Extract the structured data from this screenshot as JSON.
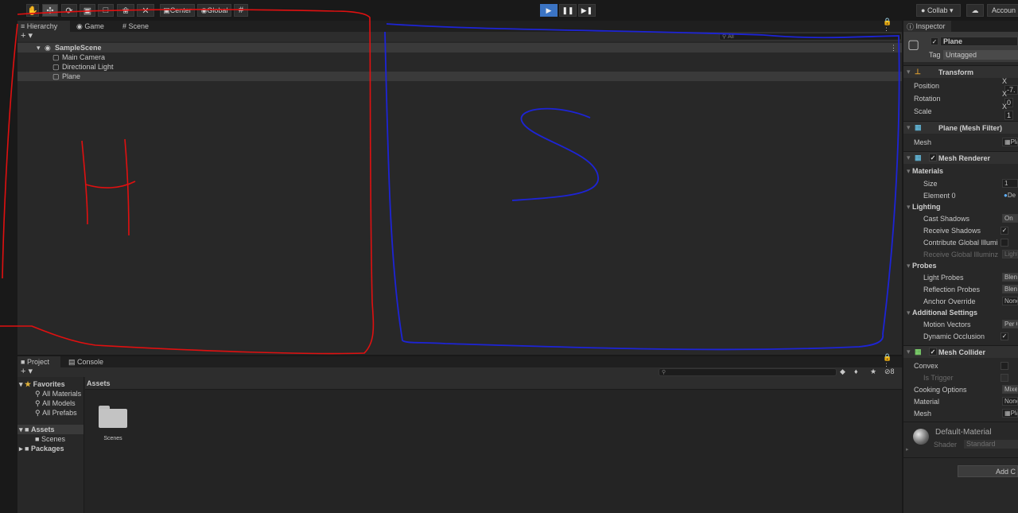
{
  "toolbar": {
    "pivot_label": "Center",
    "space_label": "Global",
    "collab_label": "Collab",
    "account_label": "Accoun"
  },
  "hierarchy": {
    "tabs": [
      "Hierarchy",
      "Game",
      "Scene"
    ],
    "add_label": "+ ▾",
    "scene_name": "SampleScene",
    "objects": [
      "Main Camera",
      "Directional Light",
      "Plane"
    ],
    "annotation_letter": "H"
  },
  "scene": {
    "search_placeholder": "All",
    "annotation_letter": "S"
  },
  "project": {
    "tabs": [
      "Project",
      "Console"
    ],
    "add_label": "+ ▾",
    "hidden_count": "8",
    "favorites_label": "Favorites",
    "favorites": [
      "All Materials",
      "All Models",
      "All Prefabs"
    ],
    "assets_label": "Assets",
    "asset_folders": [
      "Scenes"
    ],
    "packages_label": "Packages",
    "breadcrumb": "Assets",
    "grid_items": [
      "Scenes"
    ]
  },
  "inspector": {
    "tab_label": "Inspector",
    "object_name": "Plane",
    "tag_label": "Tag",
    "tag_value": "Untagged",
    "transform": {
      "title": "Transform",
      "position_label": "Position",
      "position_x": "-7.",
      "rotation_label": "Rotation",
      "rotation_x": "0",
      "scale_label": "Scale",
      "scale_x": "1"
    },
    "mesh_filter": {
      "title": "Plane (Mesh Filter)",
      "mesh_label": "Mesh",
      "mesh_value": "Pla"
    },
    "mesh_renderer": {
      "title": "Mesh Renderer",
      "materials_label": "Materials",
      "size_label": "Size",
      "size_value": "1",
      "element0_label": "Element 0",
      "element0_value": "De",
      "lighting_label": "Lighting",
      "cast_shadows_label": "Cast Shadows",
      "cast_shadows_value": "On",
      "receive_shadows_label": "Receive Shadows",
      "contribute_gi_label": "Contribute Global Illumi",
      "receive_gi_label": "Receive Global Illuminz",
      "receive_gi_value": "Light",
      "probes_label": "Probes",
      "light_probes_label": "Light Probes",
      "light_probes_value": "Blen",
      "reflection_probes_label": "Reflection Probes",
      "reflection_probes_value": "Blen",
      "anchor_override_label": "Anchor Override",
      "anchor_override_value": "None",
      "additional_label": "Additional Settings",
      "motion_vectors_label": "Motion Vectors",
      "motion_vectors_value": "Per C",
      "dynamic_occlusion_label": "Dynamic Occlusion"
    },
    "mesh_collider": {
      "title": "Mesh Collider",
      "convex_label": "Convex",
      "is_trigger_label": "Is Trigger",
      "cooking_label": "Cooking Options",
      "cooking_value": "Mixe",
      "material_label": "Material",
      "material_value": "None",
      "mesh_label": "Mesh",
      "mesh_value": "Pla"
    },
    "material": {
      "name": "Default-Material",
      "shader_label": "Shader",
      "shader_value": "Standard"
    },
    "add_component_label": "Add C"
  },
  "colors": {
    "red_annotation": "#e01010",
    "blue_annotation": "#1d24d6",
    "play_active": "#3b74c4"
  }
}
